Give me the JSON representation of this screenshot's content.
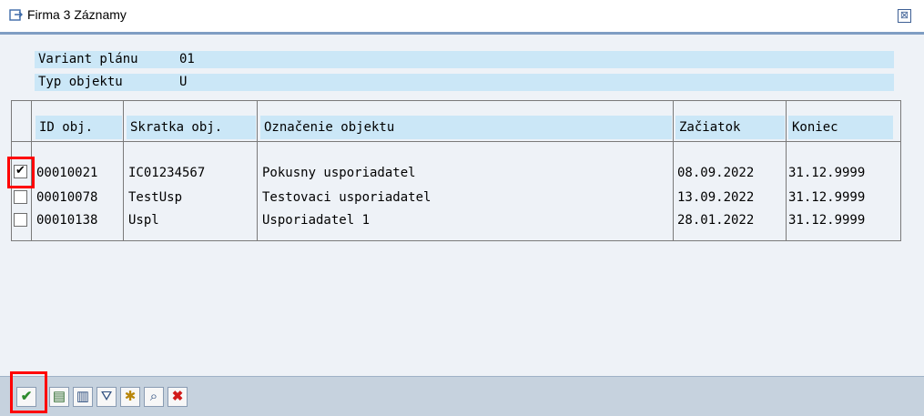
{
  "window": {
    "title": "Firma 3 Záznamy",
    "close_glyph": "⊠"
  },
  "header": {
    "variant_label": "Variant plánu",
    "variant_value": "01",
    "type_label": "Typ objektu",
    "type_value": "U"
  },
  "table": {
    "columns": [
      "ID obj.",
      "Skratka obj.",
      "Označenie objektu",
      "Začiatok",
      "Koniec"
    ],
    "rows": [
      {
        "checked": true,
        "id": "00010021",
        "short": "IC01234567",
        "name": "Pokusny usporiadatel",
        "start": "08.09.2022",
        "end": "31.12.9999"
      },
      {
        "checked": false,
        "id": "00010078",
        "short": "TestUsp",
        "name": "Testovaci usporiadatel",
        "start": "13.09.2022",
        "end": "31.12.9999"
      },
      {
        "checked": false,
        "id": "00010138",
        "short": "Uspl",
        "name": "Usporiadatel 1",
        "start": "28.01.2022",
        "end": "31.12.9999"
      }
    ]
  },
  "toolbar": {
    "buttons": [
      {
        "name": "continue-check-icon",
        "glyph": "✔",
        "color": "#2e8b2e"
      },
      {
        "name": "select-all-icon",
        "glyph": "▤",
        "color": "#2f6b2f"
      },
      {
        "name": "details-icon",
        "glyph": "▥",
        "color": "#2f4f7f"
      },
      {
        "name": "filter-icon",
        "glyph": "⛛",
        "color": "#2f4f7f"
      },
      {
        "name": "new-entries-icon",
        "glyph": "✱",
        "color": "#b8860b"
      },
      {
        "name": "find-icon",
        "glyph": "⌕",
        "color": "#2f4f7f"
      },
      {
        "name": "cancel-icon",
        "glyph": "✖",
        "color": "#d11a1a"
      }
    ]
  },
  "colors": {
    "highlight_red": "#ff0000",
    "header_blue": "#cbe7f7"
  }
}
